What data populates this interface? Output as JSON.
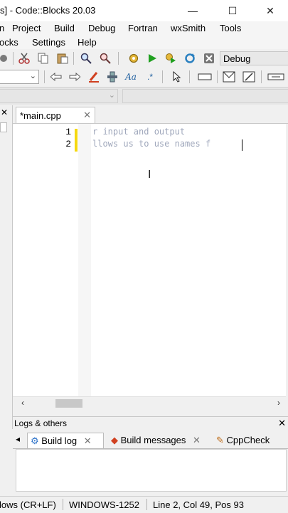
{
  "window": {
    "title": "s] - Code::Blocks 20.03",
    "minimize": "—",
    "maximize": "☐",
    "close": "✕"
  },
  "menu": {
    "row1": [
      "n",
      "Project",
      "Build",
      "Debug",
      "Fortran",
      "wxSmith",
      "Tools"
    ],
    "row2": [
      "ocks",
      "Settings",
      "Help"
    ]
  },
  "toolbar": {
    "build_target": "Debug"
  },
  "editor": {
    "tab_label": "*main.cpp",
    "tab_close": "✕",
    "line_numbers": [
      "1",
      "2"
    ],
    "lines": [
      "r input and output",
      "llows us to use names f"
    ]
  },
  "logs": {
    "title": "Logs & others",
    "close": "✕",
    "left_arrow": "◂",
    "tabs": [
      {
        "label": "Build log",
        "close": "✕"
      },
      {
        "label": "Build messages",
        "close": "✕"
      },
      {
        "label": "CppCheck"
      }
    ]
  },
  "status": {
    "line_endings": "lows (CR+LF)",
    "encoding": "WINDOWS-1252",
    "position": "Line 2, Col 49, Pos 93"
  },
  "colors": {
    "change_bar": "#f5d80f",
    "code_text": "#9fa7bb"
  }
}
